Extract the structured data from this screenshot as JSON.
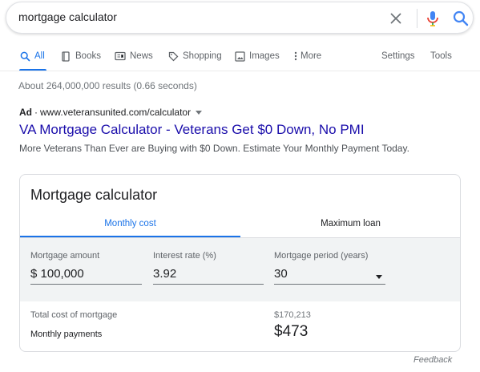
{
  "search": {
    "query": "mortgage calculator"
  },
  "tabs": [
    {
      "label": "All",
      "icon": "search-icon",
      "active": true
    },
    {
      "label": "Books",
      "icon": "book-icon"
    },
    {
      "label": "News",
      "icon": "news-icon"
    },
    {
      "label": "Shopping",
      "icon": "tag-icon"
    },
    {
      "label": "Images",
      "icon": "image-icon"
    },
    {
      "label": "More",
      "icon": "more-vertical-icon"
    }
  ],
  "tools": {
    "settings_label": "Settings",
    "tools_label": "Tools"
  },
  "results_count": "About 264,000,000 results (0.66 seconds)",
  "ad": {
    "label": "Ad",
    "url": "www.veteransunited.com/calculator",
    "title": "VA Mortgage Calculator - Veterans Get $0 Down, No PMI",
    "description": "More Veterans Than Ever are Buying with $0 Down. Estimate Your Monthly Payment Today."
  },
  "calculator": {
    "title": "Mortgage calculator",
    "tabs": [
      "Monthly cost",
      "Maximum loan"
    ],
    "active_tab": "Monthly cost",
    "fields": {
      "amount": {
        "label": "Mortgage amount",
        "value": "$ 100,000"
      },
      "rate": {
        "label": "Interest rate (%)",
        "value": "3.92"
      },
      "period": {
        "label": "Mortgage period (years)",
        "value": "30"
      }
    },
    "total_cost_label": "Total cost of mortgage",
    "total_cost_value": "$170,213",
    "monthly_label": "Monthly payments",
    "monthly_value": "$473"
  },
  "feedback_label": "Feedback",
  "colors": {
    "accent": "#1a73e8",
    "link": "#1a0dab",
    "mic_blue": "#4285f4",
    "mic_red": "#ea4335"
  }
}
